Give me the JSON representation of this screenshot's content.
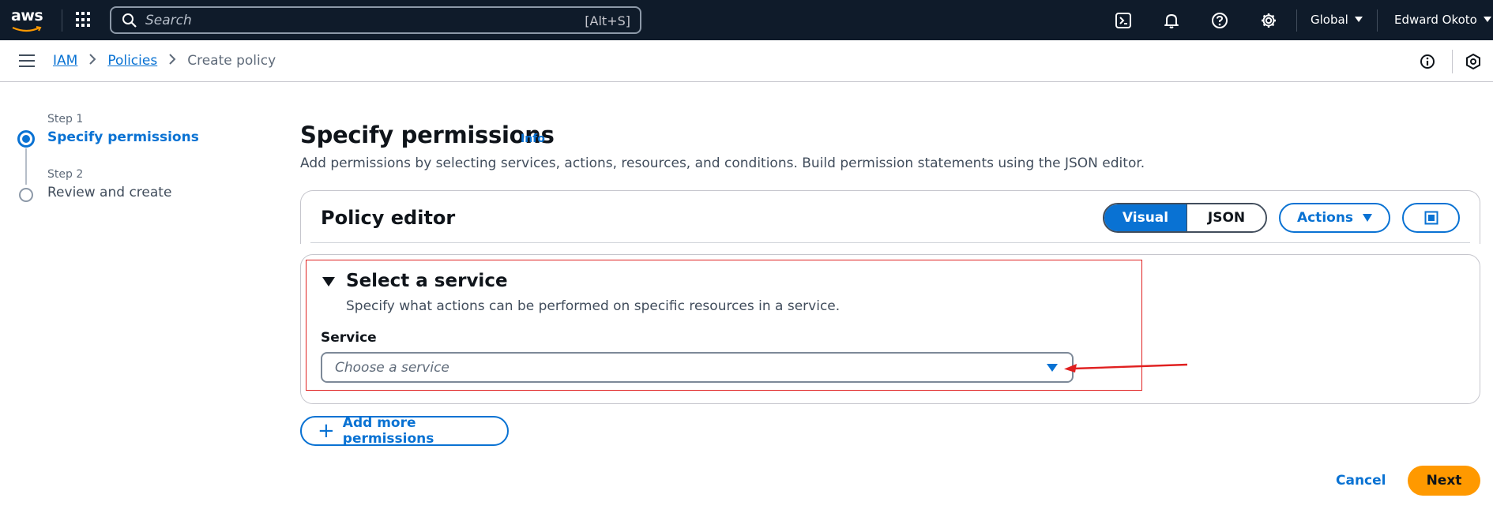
{
  "topnav": {
    "logo_text": "aws",
    "search": {
      "placeholder": "Search",
      "shortcut": "[Alt+S]"
    },
    "icons": [
      "cloudshell-icon",
      "bell-icon",
      "help-icon",
      "gear-icon"
    ],
    "region": "Global",
    "user": "Edward Okoto"
  },
  "breadcrumb": {
    "items": [
      {
        "label": "IAM"
      },
      {
        "label": "Policies"
      },
      {
        "label": "Create policy"
      }
    ]
  },
  "steps": [
    {
      "label": "Step 1",
      "title": "Specify permissions",
      "active": true
    },
    {
      "label": "Step 2",
      "title": "Review and create",
      "active": false
    }
  ],
  "main": {
    "title": "Specify permissions",
    "info": "Info",
    "description": "Add permissions by selecting services, actions, resources, and conditions. Build permission statements using the JSON editor."
  },
  "policy_editor": {
    "title": "Policy editor",
    "modes": [
      {
        "label": "Visual",
        "active": true
      },
      {
        "label": "JSON",
        "active": false
      }
    ],
    "actions_label": "Actions"
  },
  "statement": {
    "title": "Select a service",
    "description": "Specify what actions can be performed on specific resources in a service.",
    "service_label": "Service",
    "service_placeholder": "Choose a service"
  },
  "add_permissions_label": "Add more permissions",
  "footer": {
    "cancel_label": "Cancel",
    "next_label": "Next"
  },
  "colors": {
    "nav_bg": "#0f1b2a",
    "accent": "#0972d3",
    "primary_button": "#ff9900",
    "annotation": "#e02020"
  }
}
